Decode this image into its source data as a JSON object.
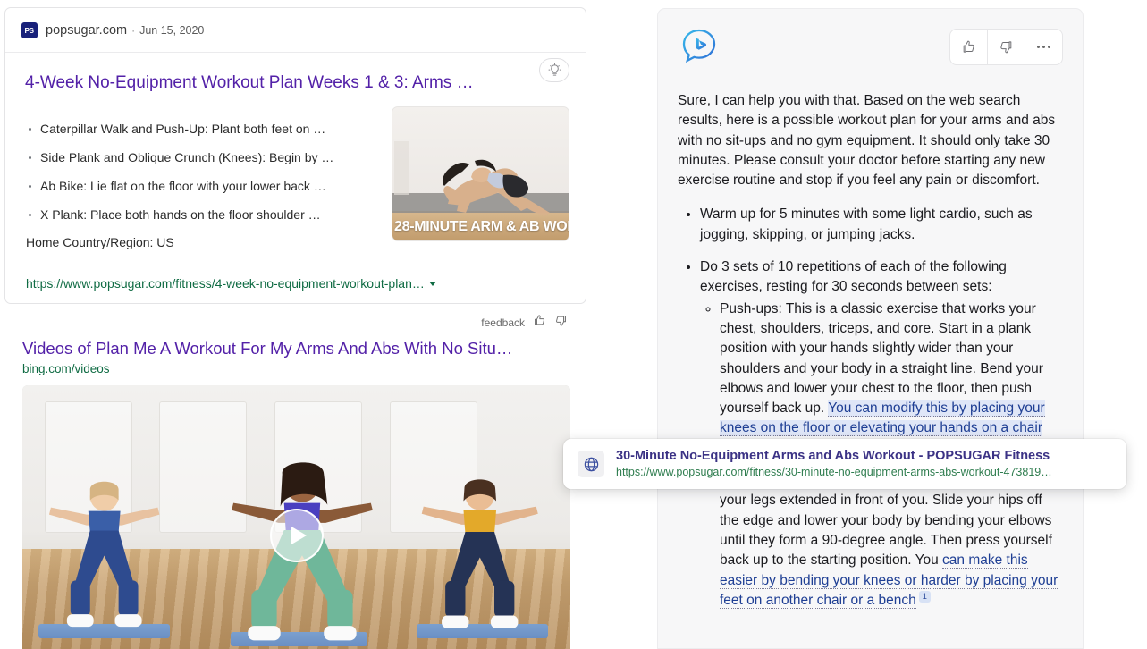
{
  "left_results": {
    "organic": {
      "favicon_text": "PS",
      "site": "popsugar.com",
      "separator": "·",
      "date": "Jun 15, 2020",
      "title": "4-Week No-Equipment Workout Plan Weeks 1 & 3: Arms …",
      "bulb_icon": "lightbulb-icon",
      "snippets": [
        "Caterpillar Walk and Push-Up: Plant both feet on …",
        "Side Plank and Oblique Crunch (Knees): Begin by …",
        "Ab Bike: Lie flat on the floor with your lower back …",
        "X Plank: Place both hands on the floor shoulder …"
      ],
      "meta": "Home Country/Region: US",
      "thumb_caption": "28-MINUTE ARM & AB WOR",
      "url": "https://www.popsugar.com/fitness/4-week-no-equipment-workout-plan…"
    },
    "feedback": {
      "label": "feedback",
      "thumbs_up_icon": "thumbs-up-icon",
      "thumbs_down_icon": "thumbs-down-icon"
    },
    "videos": {
      "title": "Videos of Plan Me A Workout For My Arms And Abs With No Situ…",
      "source": "bing.com/videos",
      "play_icon": "play-icon"
    }
  },
  "chat": {
    "logo_icon": "bing-chat-logo-icon",
    "actions": {
      "like_icon": "thumbs-up-icon",
      "dislike_icon": "thumbs-down-icon",
      "more_icon": "more-options-icon"
    },
    "intro": "Sure, I can help you with that. Based on the web search results, here is a possible workout plan for your arms and abs with no sit-ups and no gym equipment. It should only take 30 minutes. Please consult your doctor before starting any new exercise routine and stop if you feel any pain or discomfort.",
    "bullet_1": "Warm up for 5 minutes with some light cardio, such as jogging, skipping, or jumping jacks.",
    "bullet_2": "Do 3 sets of 10 repetitions of each of the following exercises, resting for 30 seconds between sets:",
    "sub_1_lead": "Push-ups: This is a classic exercise that works your chest, shoulders, triceps, and core. Start in a plank position with your hands slightly wider than your shoulders and your body in a straight line. Bend your elbows and lower your chest to the floor, then push yourself back up. ",
    "sub_1_link": "You can modify this by placing your knees on the floor or elevating your hands on a chair",
    "sub_2_lead": "muscles at the back of your arms. Sit on the edge of a chair or a bench with your hands gripping the edge and your legs extended in front of you. Slide your hips off the edge and lower your body by bending your elbows until they form a 90-degree angle. Then press yourself back up to the starting position. ",
    "sub_2_link": "can make this easier by bending your knees or harder by placing your feet on another chair or a bench",
    "sub_2_link_prefix": "You ",
    "citation_number": "1"
  },
  "tooltip": {
    "globe_icon": "globe-icon",
    "title": "30-Minute No-Equipment Arms and Abs Workout - POPSUGAR Fitness",
    "url": "https://www.popsugar.com/fitness/30-minute-no-equipment-arms-abs-workout-473819…"
  },
  "colors": {
    "link_purple": "#5321a8",
    "url_green": "#0f6b43",
    "chat_bg": "#f7f7f8",
    "citation_blue": "#1f3f94",
    "highlight_blue": "#dfe6f7",
    "favicon_navy": "#18217a"
  }
}
